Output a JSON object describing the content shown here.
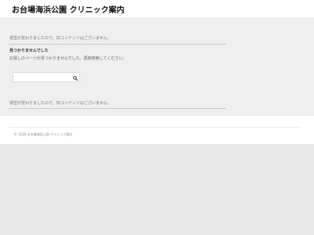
{
  "header": {
    "site_title": "お台場海浜公園 クリニック案内"
  },
  "main": {
    "notice_top": "運営が変わりましたので、旧コンテンツはございません。",
    "not_found": {
      "title": "見つかりませんでした",
      "message": "お探しのページが見つかりませんでした。再度検索してください。"
    },
    "search": {
      "value": "",
      "placeholder": "",
      "button_icon": "search-icon"
    },
    "notice_bottom": "運営が変わりましたので、旧コンテンツはございません。"
  },
  "footer": {
    "copyright": "© 2020 お台場海浜公園 クリニック案内"
  }
}
